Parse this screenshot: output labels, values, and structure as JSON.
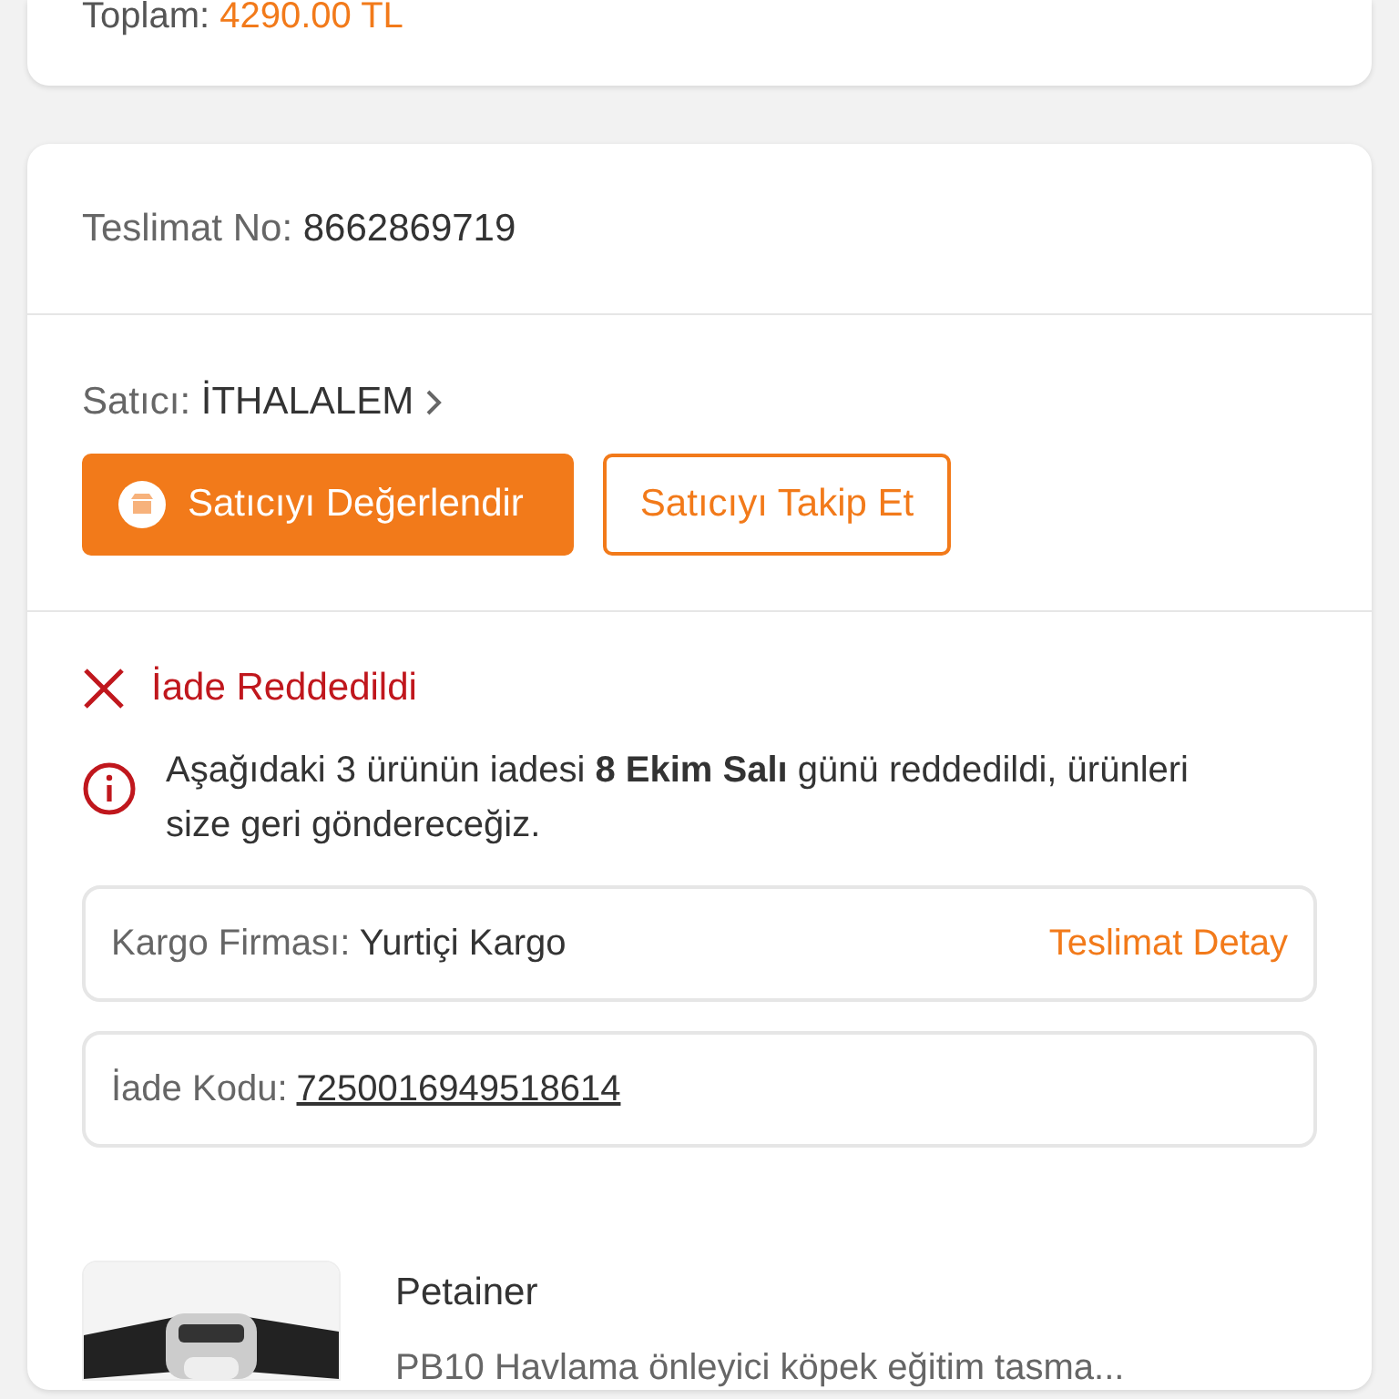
{
  "order_summary": {
    "total_label": "Toplam:",
    "total_value": "4290.00 TL"
  },
  "delivery": {
    "number_label": "Teslimat No:",
    "number_value": "8662869719"
  },
  "seller": {
    "label": "Satıcı:",
    "name": "İTHALALEM",
    "buttons": [
      {
        "label": "Satıcıyı Değerlendir",
        "kind": "primary"
      },
      {
        "label": "Satıcıyı Takip Et",
        "kind": "outline"
      }
    ]
  },
  "return": {
    "status": "İade Reddedildi",
    "message": "Aşağıdaki 3 ürünün iadesi **8 Ekim Salı** günü reddedildi, ürünleri size geri göndereceğiz.",
    "cargo_label": "Kargo Firması:",
    "cargo_value": "Yurtiçi Kargo",
    "cargo_link": "Teslimat Detay",
    "code_label": "İade Kodu:",
    "code_value": "7250016949518614"
  },
  "product": {
    "brand": "Petainer",
    "title": "PB10 Havlama önleyici köpek eğitim tasma..."
  }
}
